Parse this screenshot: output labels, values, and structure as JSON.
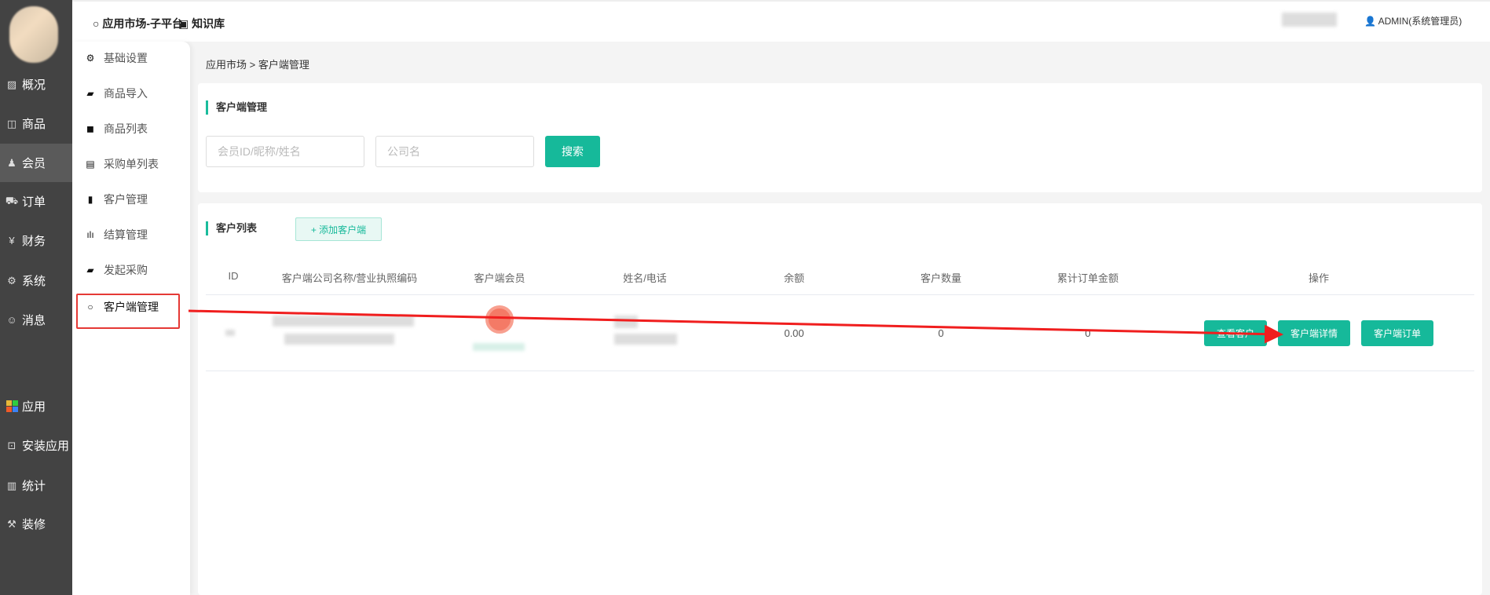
{
  "topbar": {
    "app_title": "应用市场-子平台",
    "knowledge": "知识库",
    "user": "ADMIN(系统管理员)"
  },
  "sidebar": {
    "items": [
      {
        "label": "概况",
        "icon": "chart-icon"
      },
      {
        "label": "商品",
        "icon": "bag-icon"
      },
      {
        "label": "会员",
        "icon": "users-icon",
        "active": true
      },
      {
        "label": "订单",
        "icon": "cart-icon"
      },
      {
        "label": "财务",
        "icon": "yen-icon"
      },
      {
        "label": "系统",
        "icon": "gear-icon"
      },
      {
        "label": "消息",
        "icon": "chat-icon"
      },
      {
        "label": "应用",
        "icon": "apps-icon"
      },
      {
        "label": "安装应用",
        "icon": "install-icon"
      },
      {
        "label": "统计",
        "icon": "stats-icon"
      },
      {
        "label": "装修",
        "icon": "paint-roller-icon"
      }
    ]
  },
  "submenu": {
    "items": [
      {
        "label": "基础设置"
      },
      {
        "label": "商品导入"
      },
      {
        "label": "商品列表"
      },
      {
        "label": "采购单列表"
      },
      {
        "label": "客户管理"
      },
      {
        "label": "结算管理"
      },
      {
        "label": "发起采购"
      },
      {
        "label": "客户端管理",
        "active": true
      }
    ]
  },
  "breadcrumb": "应用市场 > 客户端管理",
  "search": {
    "title": "客户端管理",
    "member_placeholder": "会员ID/昵称/姓名",
    "company_placeholder": "公司名",
    "search_label": "搜索"
  },
  "list": {
    "title": "客户列表",
    "add_label": "+ 添加客户端",
    "columns": [
      "ID",
      "客户端公司名称/营业执照编码",
      "客户端会员",
      "姓名/电话",
      "余额",
      "客户数量",
      "累计订单金额",
      "操作"
    ],
    "rows": [
      {
        "balance": "0.00",
        "customer_count": "0",
        "total_amount": "0",
        "actions": [
          "查看客户",
          "客户端详情",
          "客户端订单"
        ]
      }
    ]
  }
}
